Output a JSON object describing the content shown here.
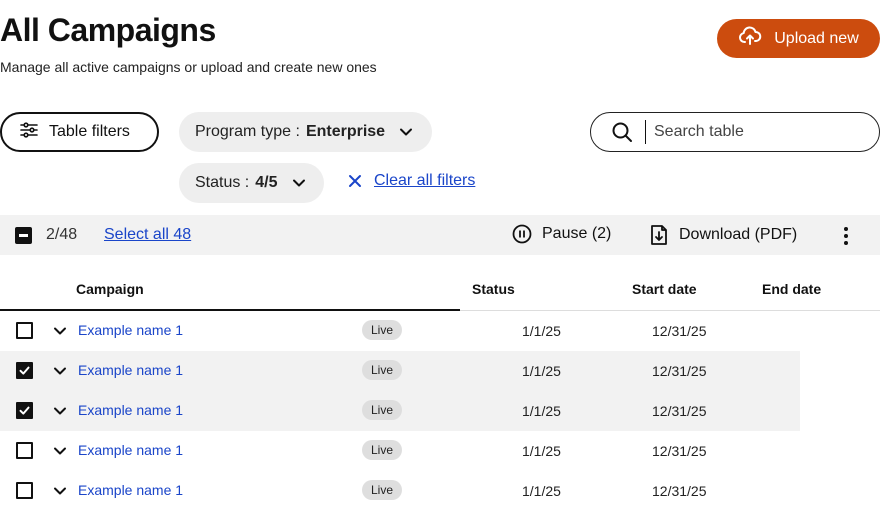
{
  "header": {
    "title": "All Campaigns",
    "subtitle": "Manage all active campaigns or upload and create new ones",
    "upload_label": "Upload new",
    "accent_color": "#cc4c0e"
  },
  "filters": {
    "table_filters_label": "Table filters",
    "program_type_label": "Program type :",
    "program_type_value": "Enterprise",
    "status_label": "Status :",
    "status_value": "4/5",
    "clear_label": "Clear all filters"
  },
  "search": {
    "placeholder": "Search table"
  },
  "toolbar": {
    "selected_count": "2/48",
    "select_all_label": "Select all 48",
    "pause_label": "Pause (2)",
    "download_label": "Download (PDF)"
  },
  "table": {
    "columns": [
      "Campaign",
      "Status",
      "Start date",
      "End date"
    ],
    "rows": [
      {
        "name": "Example name 1",
        "status": "Live",
        "start": "1/1/25",
        "end": "12/31/25",
        "checked": false
      },
      {
        "name": "Example name 1",
        "status": "Live",
        "start": "1/1/25",
        "end": "12/31/25",
        "checked": true
      },
      {
        "name": "Example name 1",
        "status": "Live",
        "start": "1/1/25",
        "end": "12/31/25",
        "checked": true
      },
      {
        "name": "Example name 1",
        "status": "Live",
        "start": "1/1/25",
        "end": "12/31/25",
        "checked": false
      },
      {
        "name": "Example name 1",
        "status": "Live",
        "start": "1/1/25",
        "end": "12/31/25",
        "checked": false
      }
    ]
  },
  "icons": {
    "upload": "cloud-upload-icon",
    "filters": "sliders-icon",
    "chevron": "chevron-down-icon",
    "clear": "close-icon",
    "search": "search-icon",
    "pause": "pause-icon",
    "download": "download-file-icon",
    "more": "more-vertical-icon"
  },
  "link_color": "#1a45c9"
}
